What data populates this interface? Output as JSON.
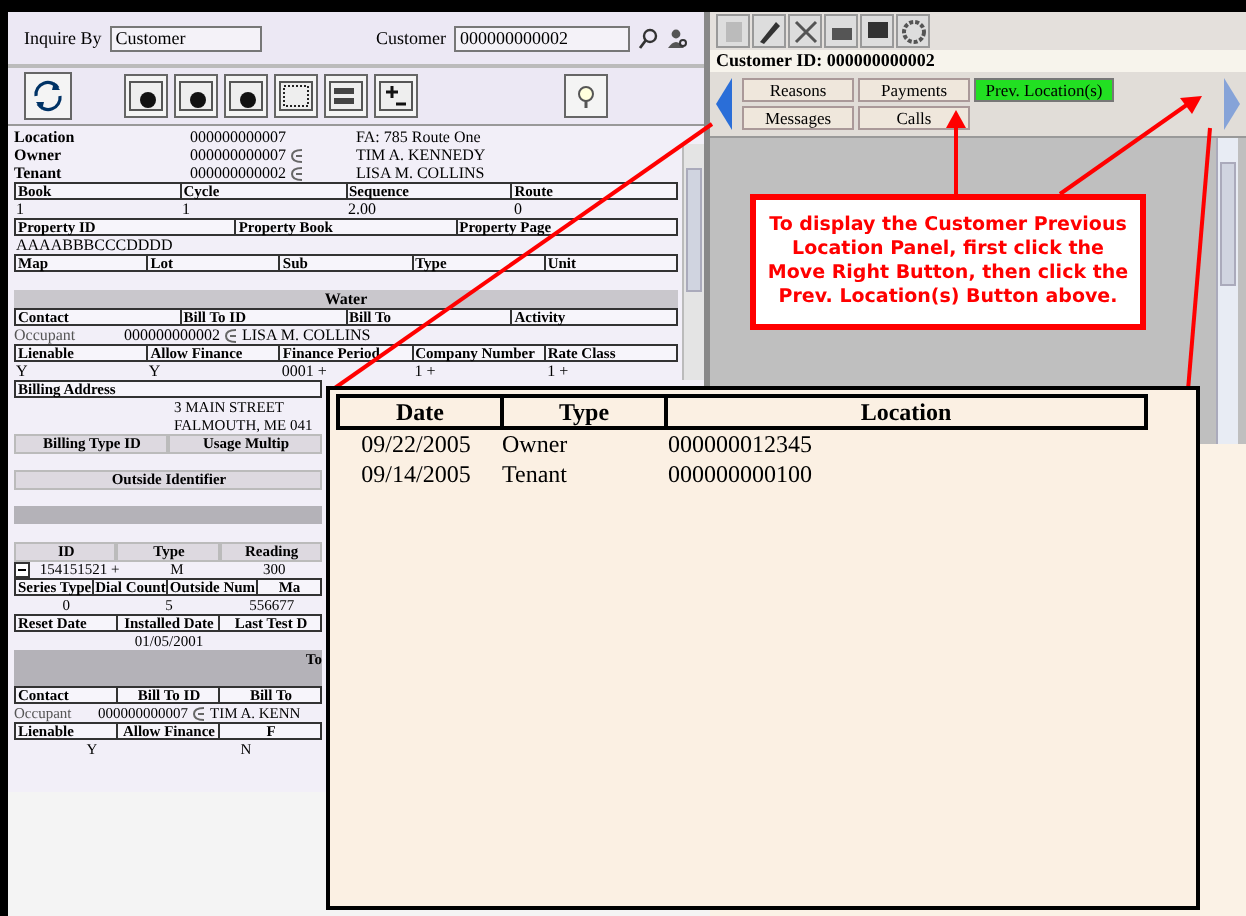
{
  "search_bar": {
    "inquire_label": "Inquire By",
    "inquire_value": "Customer",
    "customer_label": "Customer",
    "customer_value": "000000000002"
  },
  "summary": [
    {
      "label": "Location",
      "id": "000000000007",
      "name": "FA: 785 Route One",
      "link": false
    },
    {
      "label": "Owner",
      "id": "000000000007",
      "name": "TIM A. KENNEDY",
      "link": true
    },
    {
      "label": "Tenant",
      "id": "000000000002",
      "name": "LISA M. COLLINS",
      "link": true
    }
  ],
  "details": [
    {
      "kind": "header",
      "cells": [
        "Book",
        "Cycle",
        "Sequence",
        "Route"
      ]
    },
    {
      "kind": "values",
      "cells": [
        "1",
        "1",
        "2.00",
        "0"
      ]
    },
    {
      "kind": "header",
      "cells": [
        "Property ID",
        "Property Book",
        "Property Page"
      ]
    },
    {
      "kind": "values",
      "cells": [
        "AAAABBBCCCDDDD"
      ]
    },
    {
      "kind": "header",
      "cells": [
        "Map",
        "Lot",
        "Sub",
        "Type",
        "Unit"
      ]
    },
    {
      "kind": "blank"
    },
    {
      "kind": "section",
      "title": "Water"
    },
    {
      "kind": "header",
      "cells": [
        "Contact",
        "Bill To ID",
        "Bill To",
        "Activity"
      ]
    },
    {
      "kind": "contact",
      "label": "Occupant",
      "id": "000000000002",
      "name": "LISA M. COLLINS",
      "link": true
    },
    {
      "kind": "header",
      "cells": [
        "Lienable",
        "Allow Finance",
        "Finance Period",
        "Company Number",
        "Rate Class"
      ]
    },
    {
      "kind": "values",
      "cells": [
        "Y",
        "Y",
        "0001 +",
        "1 +",
        "1 +"
      ]
    }
  ],
  "lower_details": [
    {
      "kind": "header",
      "cells": [
        "Billing Address"
      ]
    },
    {
      "kind": "text",
      "text": "3 MAIN STREET"
    },
    {
      "kind": "text",
      "text": "FALMOUTH, ME 041"
    },
    {
      "kind": "subheader",
      "cells": [
        "Billing Type ID",
        "Usage Multip"
      ]
    },
    {
      "kind": "blank"
    },
    {
      "kind": "subheader",
      "cells": [
        "Outside Identifier"
      ]
    },
    {
      "kind": "blank"
    },
    {
      "kind": "section"
    },
    {
      "kind": "blank"
    },
    {
      "kind": "subheader",
      "cells": [
        "ID",
        "Type",
        "Reading"
      ]
    },
    {
      "kind": "meter",
      "expanded": true,
      "cells": [
        "154151521 +",
        "M",
        "300"
      ]
    },
    {
      "kind": "header",
      "cells": [
        "Series Type",
        "Dial Count",
        "Outside Num",
        "Ma"
      ]
    },
    {
      "kind": "values",
      "cells": [
        "0",
        "5",
        "556677"
      ]
    },
    {
      "kind": "header",
      "cells": [
        "Reset Date",
        "Installed Date",
        "Last Test D"
      ]
    },
    {
      "kind": "values",
      "cells": [
        "01/05/2001"
      ]
    },
    {
      "kind": "section",
      "title": "To"
    },
    {
      "kind": "section"
    },
    {
      "kind": "header",
      "cells": [
        "Contact",
        "Bill To ID",
        "Bill To"
      ]
    },
    {
      "kind": "contact",
      "label": "Occupant",
      "id": "000000000007",
      "name": "TIM A. KENN",
      "link": true
    },
    {
      "kind": "header",
      "cells": [
        "Lienable",
        "Allow Finance",
        "F"
      ]
    },
    {
      "kind": "values",
      "cells": [
        "Y",
        "N"
      ]
    }
  ],
  "customer_id": "Customer ID: 000000000002",
  "nav_buttons": [
    {
      "label": "Reasons",
      "selected": false
    },
    {
      "label": "Payments",
      "selected": false
    },
    {
      "label": "Prev. Location(s)",
      "selected": true
    },
    {
      "label": "Messages",
      "selected": false
    },
    {
      "label": "Calls",
      "selected": false
    }
  ],
  "callout": "To display the Customer Previous Location Panel, first click the Move Right Button, then click the Prev. Location(s) Button above.",
  "popup": {
    "columns": [
      "Date",
      "Type",
      "Location"
    ],
    "rows": [
      [
        "09/22/2005",
        "Owner",
        "000000012345"
      ],
      [
        "09/14/2005",
        "Tenant",
        "000000000100"
      ]
    ]
  }
}
